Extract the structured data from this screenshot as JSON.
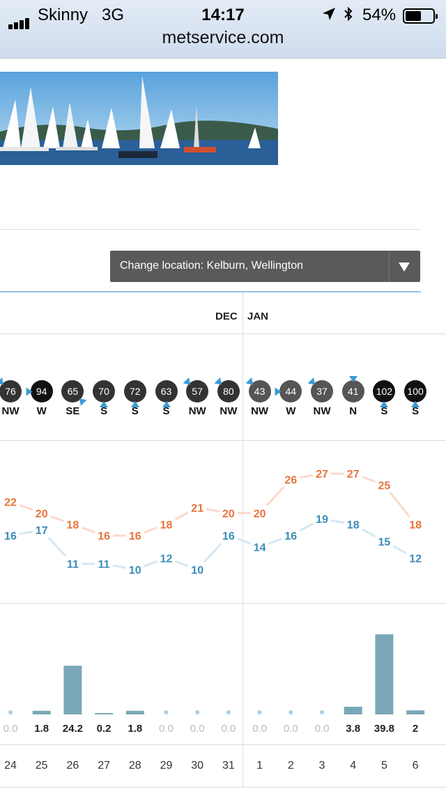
{
  "status_bar": {
    "carrier": "Skinny",
    "network": "3G",
    "time": "14:17",
    "battery": "54%",
    "battery_level": 0.54
  },
  "browser": {
    "url": "metservice.com"
  },
  "location_button": {
    "label": "Change location: Kelburn, Wellington"
  },
  "months": {
    "dec": "DEC",
    "jan": "JAN"
  },
  "days": [
    {
      "date": "24",
      "wind_speed": "76",
      "wind_dir": "NW",
      "high": "22",
      "low": "16",
      "rain": "0.0",
      "rain_mm": 0.0
    },
    {
      "date": "25",
      "wind_speed": "94",
      "wind_dir": "W",
      "high": "20",
      "low": "17",
      "rain": "1.8",
      "rain_mm": 1.8
    },
    {
      "date": "26",
      "wind_speed": "65",
      "wind_dir": "SE",
      "high": "18",
      "low": "11",
      "rain": "24.2",
      "rain_mm": 24.2
    },
    {
      "date": "27",
      "wind_speed": "70",
      "wind_dir": "S",
      "high": "16",
      "low": "11",
      "rain": "0.2",
      "rain_mm": 0.2
    },
    {
      "date": "28",
      "wind_speed": "72",
      "wind_dir": "S",
      "high": "16",
      "low": "10",
      "rain": "1.8",
      "rain_mm": 1.8
    },
    {
      "date": "29",
      "wind_speed": "63",
      "wind_dir": "S",
      "high": "18",
      "low": "12",
      "rain": "0.0",
      "rain_mm": 0.0
    },
    {
      "date": "30",
      "wind_speed": "57",
      "wind_dir": "NW",
      "high": "21",
      "low": "10",
      "rain": "0.0",
      "rain_mm": 0.0
    },
    {
      "date": "31",
      "wind_speed": "80",
      "wind_dir": "NW",
      "high": "20",
      "low": "16",
      "rain": "0.0",
      "rain_mm": 0.0
    },
    {
      "date": "1",
      "wind_speed": "43",
      "wind_dir": "NW",
      "high": "20",
      "low": "14",
      "rain": "0.0",
      "rain_mm": 0.0
    },
    {
      "date": "2",
      "wind_speed": "44",
      "wind_dir": "W",
      "high": "26",
      "low": "16",
      "rain": "0.0",
      "rain_mm": 0.0
    },
    {
      "date": "3",
      "wind_speed": "37",
      "wind_dir": "NW",
      "high": "27",
      "low": "19",
      "rain": "0.0",
      "rain_mm": 0.0
    },
    {
      "date": "4",
      "wind_speed": "41",
      "wind_dir": "N",
      "high": "27",
      "low": "18",
      "rain": "3.8",
      "rain_mm": 3.8
    },
    {
      "date": "5",
      "wind_speed": "102",
      "wind_dir": "S",
      "high": "25",
      "low": "15",
      "rain": "39.8",
      "rain_mm": 39.8
    },
    {
      "date": "6",
      "wind_speed": "100",
      "wind_dir": "S",
      "high": "18",
      "low": "12",
      "rain": "2",
      "rain_mm": 2.0
    }
  ],
  "colors": {
    "high_temp": "#e8743b",
    "low_temp": "#3b8cb8",
    "rain_bar": "#7aa8b8",
    "wind_dark": "#111111",
    "wind_mid": "#333333",
    "wind_light": "#555555",
    "wind_arrow": "#3b9ad6"
  },
  "chart_data": [
    {
      "type": "line",
      "categories": [
        "24",
        "25",
        "26",
        "27",
        "28",
        "29",
        "30",
        "31",
        "1",
        "2",
        "3",
        "4",
        "5",
        "6"
      ],
      "series": [
        {
          "values": [
            22,
            20,
            18,
            16,
            16,
            18,
            21,
            20,
            20,
            26,
            27,
            27,
            25,
            18
          ]
        },
        {
          "values": [
            16,
            17,
            11,
            11,
            10,
            12,
            10,
            16,
            14,
            16,
            19,
            18,
            15,
            12
          ]
        }
      ],
      "ylim": [
        8,
        29
      ],
      "grid": false
    },
    {
      "type": "bar",
      "categories": [
        "24",
        "25",
        "26",
        "27",
        "28",
        "29",
        "30",
        "31",
        "1",
        "2",
        "3",
        "4",
        "5",
        "6"
      ],
      "values": [
        0.0,
        1.8,
        24.2,
        0.2,
        1.8,
        0.0,
        0.0,
        0.0,
        0.0,
        0.0,
        0.0,
        3.8,
        39.8,
        2.0
      ],
      "ylim": [
        0,
        45
      ],
      "grid": false
    }
  ]
}
